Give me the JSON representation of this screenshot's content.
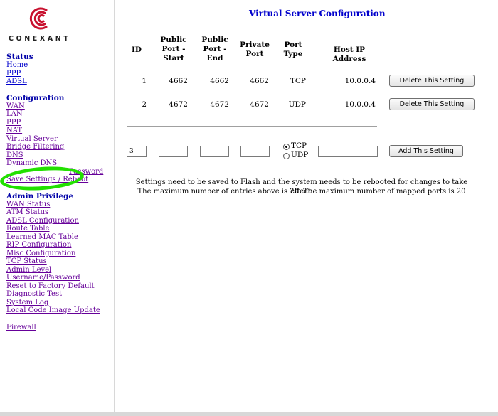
{
  "sidebar": {
    "brand": "CONEXANT",
    "status_heading": "Status",
    "status_links": [
      "Home",
      "PPP",
      "ADSL"
    ],
    "config_heading": "Configuration",
    "config_links": [
      "WAN",
      "LAN",
      "PPP",
      "NAT",
      "Virtual Server",
      "Bridge Filtering",
      "DNS",
      "Dynamic DNS",
      "Password",
      "Save Settings / Reboot"
    ],
    "admin_heading": "Admin Privilege",
    "admin_links": [
      "WAN Status",
      "ATM Status",
      "ADSL Configuration",
      "Route Table",
      "Learned MAC Table",
      "RIP Configuration",
      "Misc Configuration",
      "TCP Status",
      "Admin Level",
      "Username/Password",
      "Reset to Factory Default",
      "Diagnostic Test",
      "System Log",
      "Local Code Image Update"
    ],
    "firewall_link": "Firewall"
  },
  "page": {
    "title": "Virtual Server Configuration",
    "headers": {
      "id": "ID",
      "pub_start": "Public Port - Start",
      "pub_end": "Public Port - End",
      "private": "Private Port",
      "type": "Port Type",
      "host": "Host IP Address"
    },
    "rows": [
      {
        "id": "1",
        "pub_start": "4662",
        "pub_end": "4662",
        "private": "4662",
        "type": "TCP",
        "host": "10.0.0.4",
        "button": "Delete This Setting"
      },
      {
        "id": "2",
        "pub_start": "4672",
        "pub_end": "4672",
        "private": "4672",
        "type": "UDP",
        "host": "10.0.0.4",
        "button": "Delete This Setting"
      }
    ],
    "new_entry": {
      "id_value": "3",
      "radio_tcp": "TCP",
      "radio_udp": "UDP",
      "selected": "TCP",
      "add_button": "Add This Setting"
    },
    "note_line1": "Settings need to be saved to Flash and the system needs to be rebooted for changes to take effect.",
    "note_line2": "The maximum number of entries above is 20. The maximum number of mapped ports is 20"
  },
  "colors": {
    "link": "#660099",
    "heading": "#0000a8",
    "title": "#0000cc",
    "highlight": "#22e000",
    "logo": "#c8102e"
  },
  "icons": {
    "logo": "conexant-logo-icon",
    "radio_on": "radio-selected-icon",
    "radio_off": "radio-unselected-icon"
  }
}
